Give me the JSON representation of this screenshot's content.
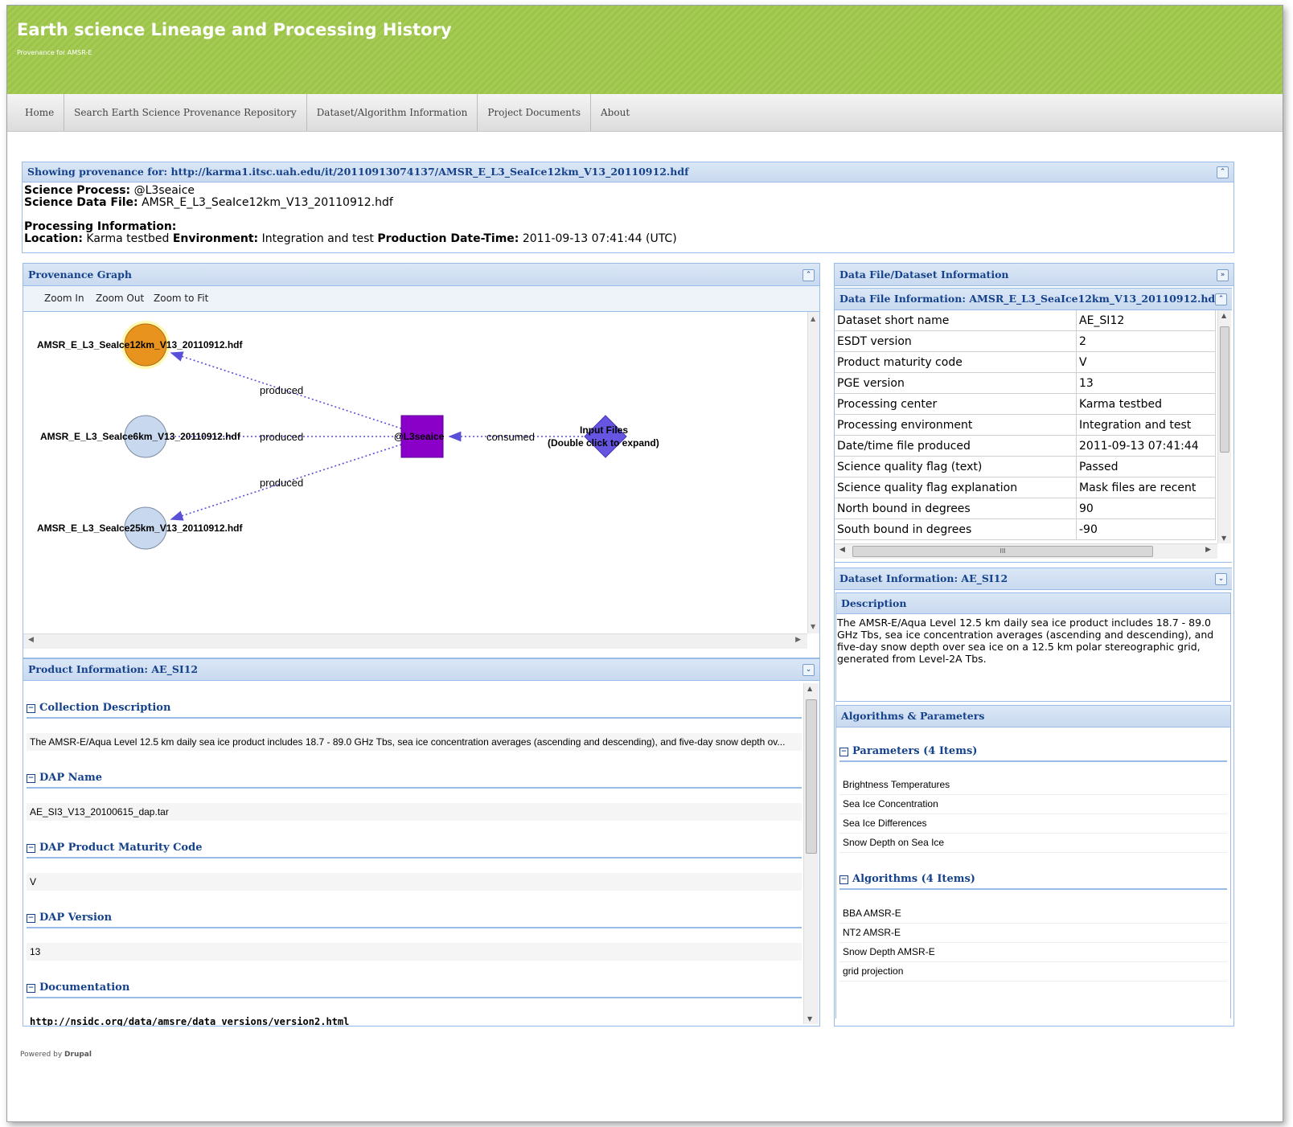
{
  "site": {
    "title": "Earth science Lineage and Processing History",
    "slogan": "Provenance for AMSR-E"
  },
  "nav": {
    "items": [
      "Home",
      "Search Earth Science Provenance Repository",
      "Dataset/Algorithm Information",
      "Project Documents",
      "About"
    ]
  },
  "provenance_header": {
    "title": "Showing provenance for: http://karma1.itsc.uah.edu/it/20110913074137/AMSR_E_L3_SeaIce12km_V13_20110912.hdf",
    "science_process_label": "Science Process:",
    "science_process": "@L3seaice",
    "science_data_file_label": "Science Data File:",
    "science_data_file": "AMSR_E_L3_SeaIce12km_V13_20110912.hdf",
    "processing_info_label": "Processing Information:",
    "location_label": "Location:",
    "location": "Karma testbed",
    "environment_label": "Environment:",
    "environment": "Integration and test",
    "production_label": "Production Date-Time:",
    "production": "2011-09-13 07:41:44 (UTC)"
  },
  "graph_panel": {
    "title": "Provenance Graph",
    "zoom_in": "Zoom In",
    "zoom_out": "Zoom Out",
    "zoom_fit": "Zoom to Fit",
    "nodes": {
      "file12": "AMSR_E_L3_SeaIce12km_V13_20110912.hdf",
      "file6": "AMSR_E_L3_SeaIce6km_V13_20110912.hdf",
      "file25": "AMSR_E_L3_SeaIce25km_V13_20110912.hdf",
      "process": "@L3seaice",
      "input_line1": "Input Files",
      "input_line2": "(Double click to expand)"
    },
    "edges": {
      "produced1": "produced",
      "produced2": "produced",
      "produced3": "produced",
      "consumed": "consumed"
    },
    "colors": {
      "selected_node": "#e8931e",
      "file_node": "#c8d8ee",
      "process_node": "#8a00c8",
      "input_node": "#6655e0",
      "edge": "#5a4fd8"
    }
  },
  "product_panel": {
    "title": "Product Information: AE_SI12",
    "sections": [
      {
        "label": "Collection Description",
        "value": "The AMSR-E/Aqua Level 12.5 km daily sea ice product includes 18.7 - 89.0 GHz Tbs, sea ice concentration averages (ascending and descending), and five-day snow depth ov..."
      },
      {
        "label": "DAP Name",
        "value": "AE_SI3_V13_20100615_dap.tar"
      },
      {
        "label": "DAP Product Maturity Code",
        "value": "V"
      },
      {
        "label": "DAP Version",
        "value": "13"
      },
      {
        "label": "Documentation",
        "value": "http://nsidc.org/data/amsre/data_versions/version2.html"
      }
    ]
  },
  "dataset_panel": {
    "title": "Data File/Dataset Information",
    "file_info_title": "Data File Information: AMSR_E_L3_SeaIce12km_V13_20110912.hdf",
    "rows": [
      [
        "Dataset short name",
        "AE_SI12"
      ],
      [
        "ESDT version",
        "2"
      ],
      [
        "Product maturity code",
        "V"
      ],
      [
        "PGE version",
        "13"
      ],
      [
        "Processing center",
        "Karma testbed"
      ],
      [
        "Processing environment",
        "Integration and test"
      ],
      [
        "Date/time file produced",
        "2011-09-13 07:41:44"
      ],
      [
        "Science quality flag (text)",
        "Passed"
      ],
      [
        "Science quality flag explanation",
        "Mask files are recent"
      ],
      [
        "North bound in degrees",
        "90"
      ],
      [
        "South bound in degrees",
        "-90"
      ]
    ],
    "hscroll_grip": "III",
    "dataset_info_title": "Dataset Information: AE_SI12",
    "description_title": "Description",
    "description": "The AMSR-E/Aqua Level 12.5 km daily sea ice product includes 18.7 - 89.0 GHz Tbs, sea ice concentration averages (ascending and descending), and five-day snow depth over sea ice on a 12.5 km polar stereographic grid, generated from Level-2A Tbs.",
    "algorithms_title": "Algorithms & Parameters",
    "parameters_title": "Parameters (4 Items)",
    "parameters": [
      "Brightness Temperatures",
      "Sea Ice Concentration",
      "Sea Ice Differences",
      "Snow Depth on Sea Ice"
    ],
    "algorithms_list_title": "Algorithms (4 Items)",
    "algorithms": [
      "BBA AMSR-E",
      "NT2 AMSR-E",
      "Snow Depth AMSR-E",
      "grid projection"
    ]
  },
  "footer": {
    "powered_by": "Powered by",
    "drupal": "Drupal"
  }
}
